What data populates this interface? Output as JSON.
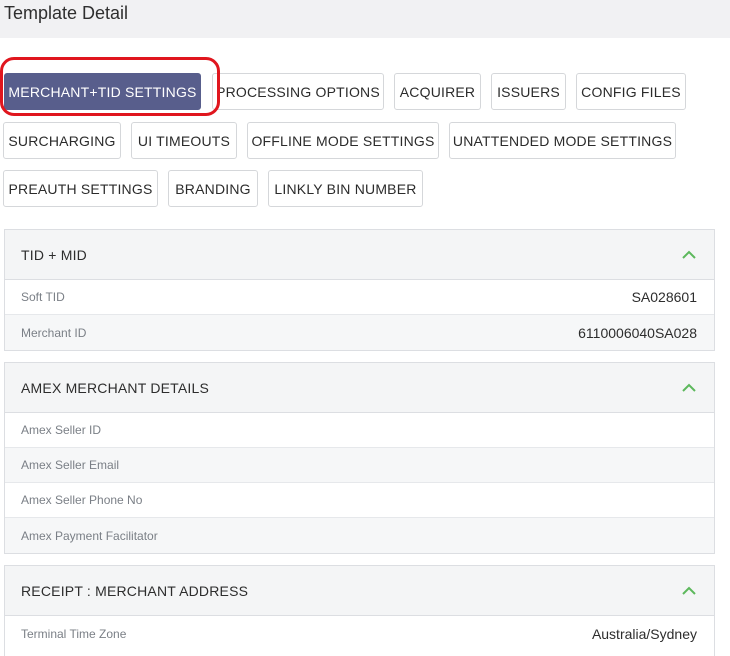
{
  "page": {
    "title": "Template Detail"
  },
  "tabs": [
    {
      "label": "MERCHANT+TID SETTINGS",
      "active": true
    },
    {
      "label": "PROCESSING OPTIONS"
    },
    {
      "label": "ACQUIRER"
    },
    {
      "label": "ISSUERS"
    },
    {
      "label": "CONFIG FILES"
    },
    {
      "label": "SURCHARGING"
    },
    {
      "label": "UI TIMEOUTS"
    },
    {
      "label": "OFFLINE MODE SETTINGS"
    },
    {
      "label": "UNATTENDED MODE SETTINGS"
    },
    {
      "label": "PREAUTH SETTINGS"
    },
    {
      "label": "BRANDING"
    },
    {
      "label": "LINKLY BIN NUMBER"
    }
  ],
  "panels": [
    {
      "title": "TID + MID",
      "icon": "chevron-up-icon",
      "rows": [
        {
          "label": "Soft TID",
          "value": "SA028601"
        },
        {
          "label": "Merchant ID",
          "value": "6110006040SA028"
        }
      ]
    },
    {
      "title": "AMEX MERCHANT DETAILS",
      "icon": "chevron-up-icon",
      "rows": [
        {
          "label": "Amex Seller ID",
          "value": ""
        },
        {
          "label": "Amex Seller Email",
          "value": ""
        },
        {
          "label": "Amex Seller Phone No",
          "value": ""
        },
        {
          "label": "Amex Payment Facilitator",
          "value": ""
        }
      ]
    },
    {
      "title": "RECEIPT : MERCHANT ADDRESS",
      "icon": "chevron-up-icon",
      "rows": [
        {
          "label": "Terminal Time Zone",
          "value": "Australia/Sydney"
        }
      ]
    }
  ],
  "colors": {
    "active_tab": "#585e8c",
    "highlight_ring": "#e0161e",
    "chevron": "#5cb85c"
  }
}
